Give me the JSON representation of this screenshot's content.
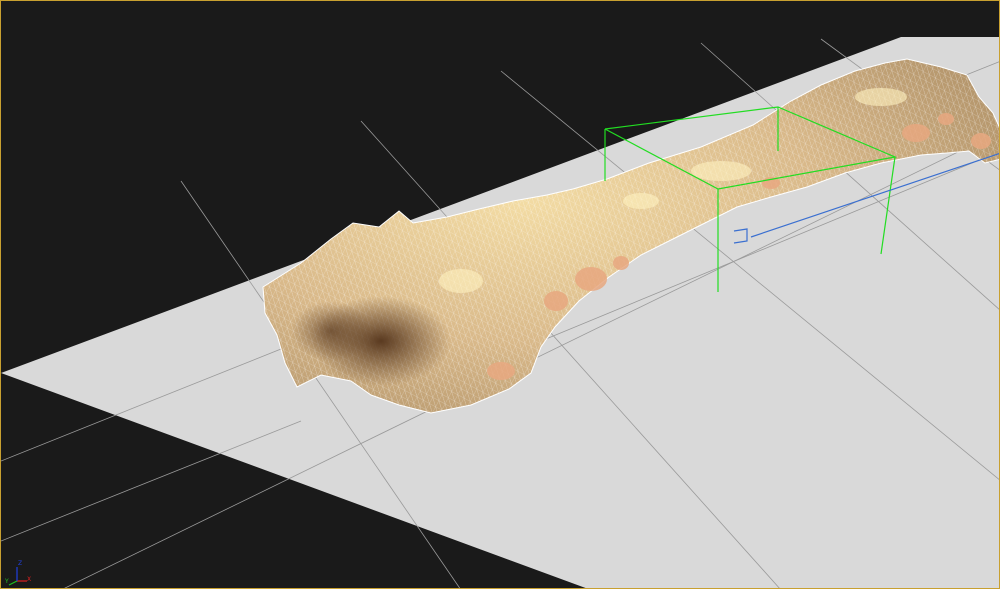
{
  "viewport": {
    "background_color": "#1a1a1a",
    "border_color": "#c8a030",
    "ground_plane_color": "#d9d9d9",
    "grid_line_color": "#9a9a9a",
    "mesh_fill_color": "#d9b98a",
    "wireframe_color": "#ffffff",
    "selection_box_color": "#22dd22",
    "camera_line_color": "#3a6fd0"
  },
  "axis_tripod": {
    "x_label": "X",
    "y_label": "Y",
    "z_label": "Z",
    "x_color": "#e02020",
    "y_color": "#20c020",
    "z_color": "#2040e0"
  }
}
